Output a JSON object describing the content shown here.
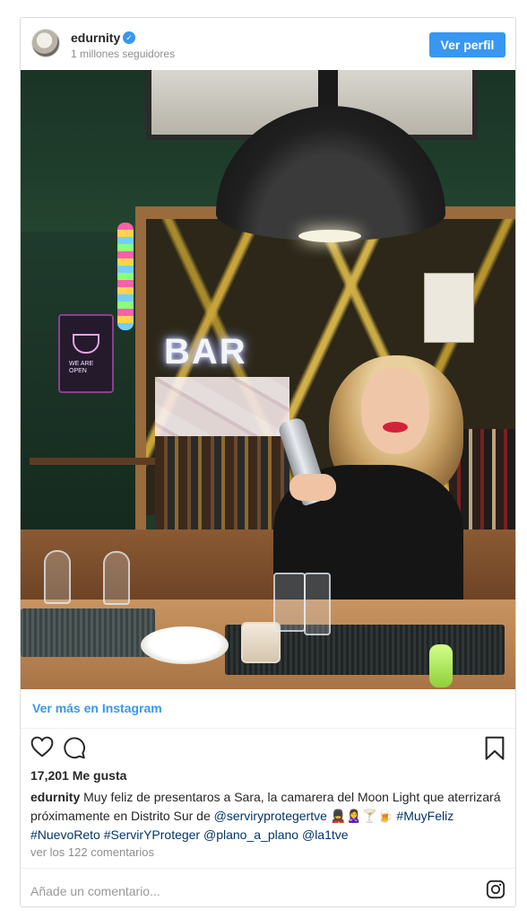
{
  "post": {
    "username": "edurnity",
    "verified_mark": "✓",
    "followers": "1 millones seguidores",
    "view_profile_label": "Ver perfil",
    "photo": {
      "neon_text": "BAR",
      "neon_sign_text": "WE ARE OPEN"
    },
    "view_more_label": "Ver más en Instagram",
    "likes": "17,201 Me gusta",
    "caption": {
      "username": "edurnity",
      "text": "Muy feliz de presentaros a Sara, la camarera del Moon Light que aterrizará próximamente en Distrito Sur de ",
      "mention1": "@serviryprotegertve",
      "emojis": " 💂‍♀️🙎‍♀️🍸🍺 ",
      "hashtag1": "#MuyFeliz",
      "hashtag2": "#NuevoReto",
      "hashtag3": "#ServirYProteger",
      "mention2": "@plano_a_plano",
      "mention3": "@la1tve"
    },
    "view_comments": "ver los 122 comentarios",
    "comment_placeholder": "Añade un comentario..."
  },
  "icons": [
    "heart-icon",
    "comment-icon",
    "bookmark-icon",
    "instagram-icon",
    "verified-icon"
  ],
  "colors": {
    "accent": "#3897f0",
    "link": "#003569",
    "muted": "#8e8e8e",
    "border": "#dbdbdb"
  }
}
